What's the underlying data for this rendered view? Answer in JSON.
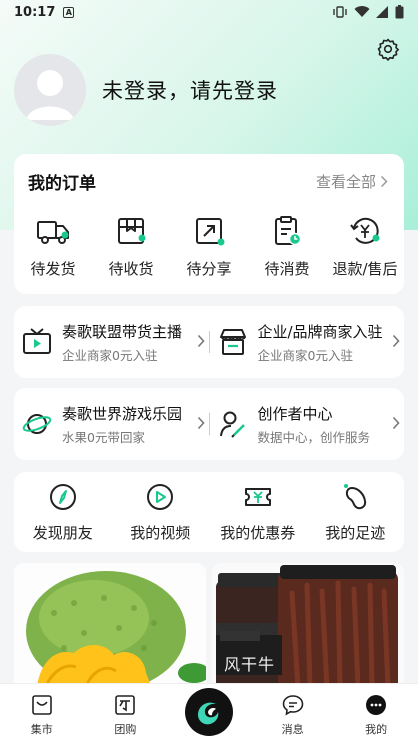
{
  "status_bar": {
    "time": "10:17",
    "notification_glyph": "A"
  },
  "header": {
    "login_prompt": "未登录，请先登录"
  },
  "orders": {
    "title": "我的订单",
    "view_all": "查看全部",
    "items": [
      {
        "label": "待发货",
        "icon": "truck-icon"
      },
      {
        "label": "待收货",
        "icon": "package-icon"
      },
      {
        "label": "待分享",
        "icon": "share-icon"
      },
      {
        "label": "待消费",
        "icon": "clipboard-clock-icon"
      },
      {
        "label": "退款/售后",
        "icon": "refund-icon"
      }
    ]
  },
  "services_row1": [
    {
      "title": "奏歌联盟带货主播",
      "subtitle": "企业商家0元入驻",
      "icon": "tv-play-icon"
    },
    {
      "title": "企业/品牌商家入驻",
      "subtitle": "企业商家0元入驻",
      "icon": "storefront-icon"
    }
  ],
  "services_row2": [
    {
      "title": "奏歌世界游戏乐园",
      "subtitle": "水果0元带回家",
      "icon": "planet-icon"
    },
    {
      "title": "创作者中心",
      "subtitle": "数据中心，创作服务",
      "icon": "creator-icon"
    }
  ],
  "features": [
    {
      "label": "发现朋友",
      "icon": "compass-icon"
    },
    {
      "label": "我的视频",
      "icon": "video-play-icon"
    },
    {
      "label": "我的优惠券",
      "icon": "coupon-icon"
    },
    {
      "label": "我的足迹",
      "icon": "footprint-icon"
    }
  ],
  "products": {
    "right_jar_label": "风干牛"
  },
  "tabbar": [
    {
      "label": "集市",
      "icon": "shopping-bag-icon"
    },
    {
      "label": "团购",
      "icon": "group-buy-icon"
    },
    {
      "label": "",
      "icon": "center-logo-icon"
    },
    {
      "label": "消息",
      "icon": "message-icon"
    },
    {
      "label": "我的",
      "icon": "profile-icon",
      "active": true
    }
  ],
  "colors": {
    "accent": "#19c98b",
    "gradient_end": "#a9efd9"
  }
}
